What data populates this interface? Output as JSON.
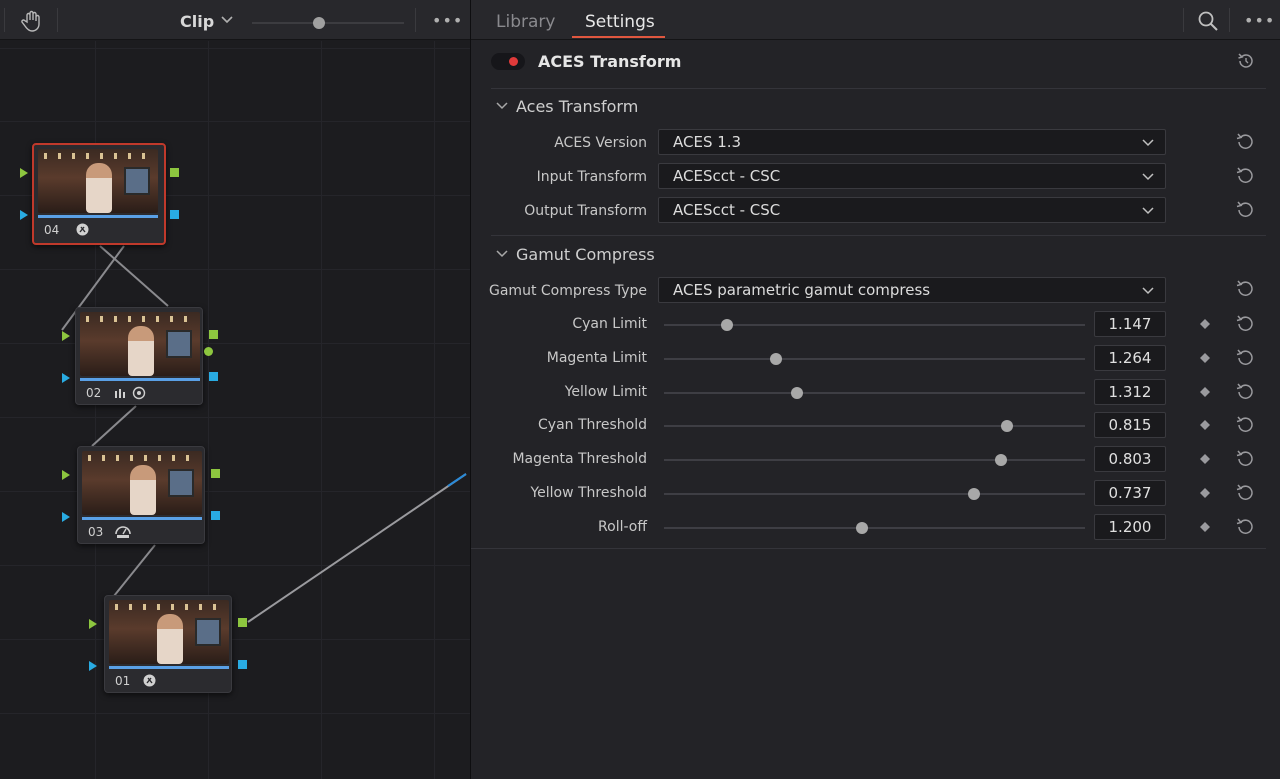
{
  "node_editor": {
    "toolbar": {
      "mode_label": "Clip",
      "more_label": "•••",
      "zoom_level": 0.44
    },
    "nodes": [
      {
        "number": "04",
        "icon": "fx-icon",
        "selected": true
      },
      {
        "number": "02",
        "icon": "scopes-and-circle-icon",
        "selected": false
      },
      {
        "number": "03",
        "icon": "hdr-icon",
        "selected": false
      },
      {
        "number": "01",
        "icon": "fx-icon",
        "selected": false
      }
    ]
  },
  "settings": {
    "tabs": [
      {
        "label": "Library",
        "active": false
      },
      {
        "label": "Settings",
        "active": true
      }
    ],
    "more_label": "•••",
    "effect": {
      "title": "ACES Transform",
      "enabled": true
    },
    "sections": {
      "aces_transform": {
        "title": "Aces Transform",
        "rows": [
          {
            "label": "ACES Version",
            "value": "ACES 1.3"
          },
          {
            "label": "Input Transform",
            "value": "ACEScct - CSC"
          },
          {
            "label": "Output Transform",
            "value": "ACEScct - CSC"
          }
        ]
      },
      "gamut_compress": {
        "title": "Gamut Compress",
        "type_label": "Gamut Compress Type",
        "type_value": "ACES parametric gamut compress",
        "sliders": [
          {
            "label": "Cyan Limit",
            "value": "1.147",
            "position": 0.15
          },
          {
            "label": "Magenta Limit",
            "value": "1.264",
            "position": 0.265
          },
          {
            "label": "Yellow Limit",
            "value": "1.312",
            "position": 0.315
          },
          {
            "label": "Cyan Threshold",
            "value": "0.815",
            "position": 0.815
          },
          {
            "label": "Magenta Threshold",
            "value": "0.803",
            "position": 0.8
          },
          {
            "label": "Yellow Threshold",
            "value": "0.737",
            "position": 0.737
          },
          {
            "label": "Roll-off",
            "value": "1.200",
            "position": 0.47
          }
        ]
      }
    }
  },
  "colors": {
    "accent_underline": "#e0573f",
    "toggle_on": "#e03a3a",
    "selected_node_border": "#c0392b",
    "port_green": "#8dc63f",
    "port_blue": "#29abe2"
  }
}
